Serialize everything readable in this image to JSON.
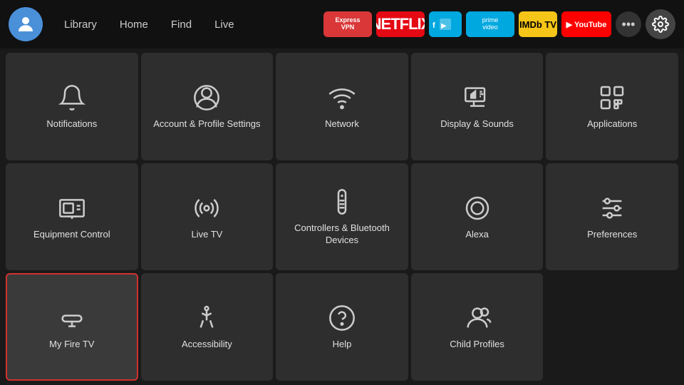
{
  "nav": {
    "links": [
      "Library",
      "Home",
      "Find",
      "Live"
    ],
    "apps": [
      {
        "label": "ExpressVPN",
        "id": "expressvpn"
      },
      {
        "label": "NETFLIX",
        "id": "netflix"
      },
      {
        "label": "FreeVee",
        "id": "freevee"
      },
      {
        "label": "prime video",
        "id": "prime"
      },
      {
        "label": "IMDb TV",
        "id": "imdb"
      },
      {
        "label": "YouTube",
        "id": "youtube"
      }
    ],
    "more_label": "•••"
  },
  "grid": {
    "items": [
      {
        "id": "notifications",
        "label": "Notifications",
        "icon": "bell"
      },
      {
        "id": "account-profile",
        "label": "Account & Profile Settings",
        "icon": "user-circle"
      },
      {
        "id": "network",
        "label": "Network",
        "icon": "wifi"
      },
      {
        "id": "display-sounds",
        "label": "Display & Sounds",
        "icon": "display-sound"
      },
      {
        "id": "applications",
        "label": "Applications",
        "icon": "apps"
      },
      {
        "id": "equipment-control",
        "label": "Equipment Control",
        "icon": "tv-monitor"
      },
      {
        "id": "live-tv",
        "label": "Live TV",
        "icon": "broadcast"
      },
      {
        "id": "controllers-bluetooth",
        "label": "Controllers & Bluetooth Devices",
        "icon": "remote"
      },
      {
        "id": "alexa",
        "label": "Alexa",
        "icon": "alexa"
      },
      {
        "id": "preferences",
        "label": "Preferences",
        "icon": "sliders"
      },
      {
        "id": "my-fire-tv",
        "label": "My Fire TV",
        "icon": "fire-stick",
        "selected": true
      },
      {
        "id": "accessibility",
        "label": "Accessibility",
        "icon": "accessibility"
      },
      {
        "id": "help",
        "label": "Help",
        "icon": "help-circle"
      },
      {
        "id": "child-profiles",
        "label": "Child Profiles",
        "icon": "child-profile"
      }
    ]
  }
}
